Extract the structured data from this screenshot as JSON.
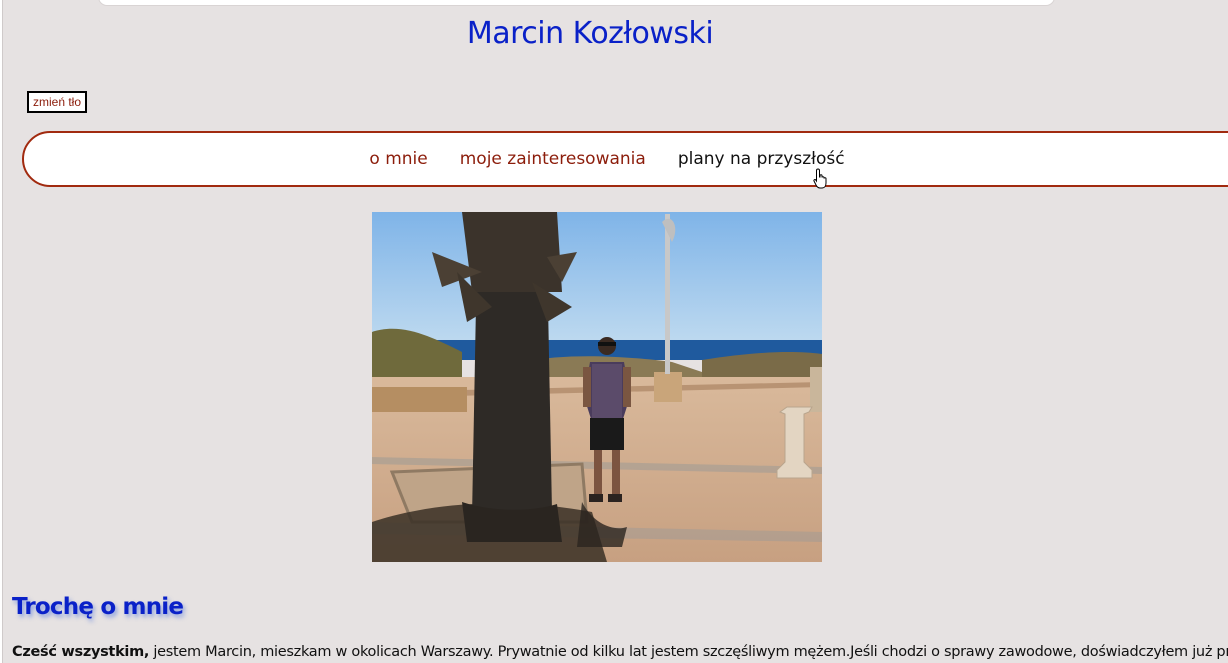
{
  "header": {
    "title": "Marcin Kozłowski",
    "background_button_label": "zmień tło"
  },
  "nav": {
    "items": [
      {
        "label": "o mnie"
      },
      {
        "label": "moje zainteresowania"
      },
      {
        "label": "plany na przyszłość"
      }
    ]
  },
  "photo": {
    "alt": "Zdjęcie"
  },
  "about": {
    "heading": "Trochę o mnie",
    "greeting": "Cześć wszystkim,",
    "text": " jestem Marcin, mieszkam w okolicach Warszawy. Prywatnie od kilku lat jestem szczęśliwym mężem.Jeśli chodzi o sprawy zawodowe, doświadczyłem już pracy"
  },
  "colors": {
    "title": "#0a21c8",
    "nav_link": "#8c1d0b",
    "nav_border": "#a12a0f",
    "page_background": "#e6e2e2"
  }
}
